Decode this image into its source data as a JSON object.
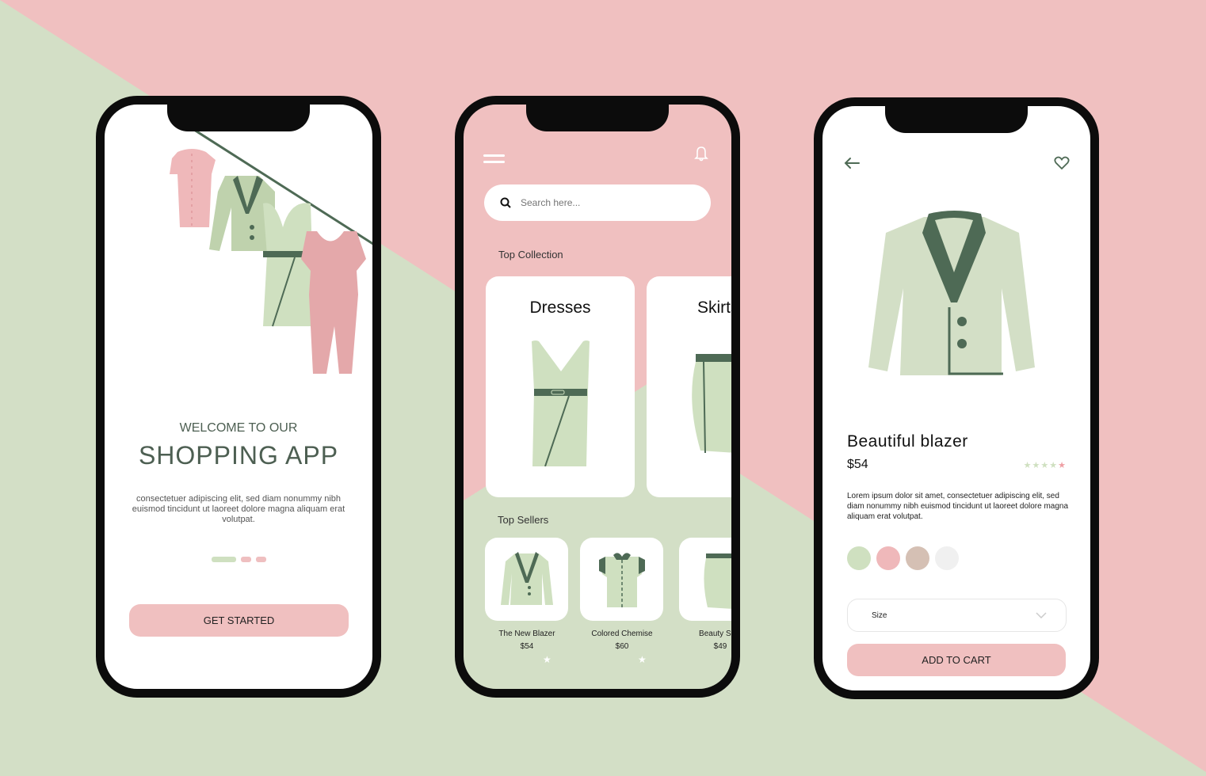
{
  "colors": {
    "pink": "#f0c0c0",
    "green": "#d3dfc6",
    "dark_green": "#4e6a55",
    "dress_pink": "#e4a8aa",
    "light_green": "#cfe0c0"
  },
  "welcome_screen": {
    "subtitle": "WELCOME TO OUR",
    "title": "SHOPPING APP",
    "description": "consectetuer adipiscing elit, sed diam nonummy nibh euismod tincidunt ut laoreet dolore magna aliquam erat volutpat.",
    "pager": {
      "total": 3,
      "active": 1
    },
    "cta_label": "GET STARTED"
  },
  "home_screen": {
    "menu_icon": "hamburger-icon",
    "bell_icon": "bell-icon",
    "search": {
      "placeholder": "Search here...",
      "value": ""
    },
    "top_collection_label": "Top Collection",
    "collections": [
      {
        "label": "Dresses"
      },
      {
        "label": "Skirts"
      }
    ],
    "top_sellers_label": "Top Sellers",
    "sellers": [
      {
        "name": "The New Blazer",
        "price": "$54"
      },
      {
        "name": "Colored Chemise",
        "price": "$60"
      },
      {
        "name": "Beauty Skirt",
        "price": "$49"
      }
    ]
  },
  "detail_screen": {
    "back_icon": "arrow-left-icon",
    "favorite_icon": "heart-icon",
    "title": "Beautiful blazer",
    "price": "$54",
    "rating": {
      "stars": 5,
      "highlighted": 1
    },
    "description": "Lorem ipsum dolor sit amet, consectetuer adipiscing elit, sed diam nonummy nibh euismod tincidunt ut laoreet dolore magna aliquam erat volutpat.",
    "swatches": [
      "#cfe0c0",
      "#efb8ba",
      "#d5c0b4",
      "#f0f0f0"
    ],
    "size_label": "Size",
    "cta_label": "ADD TO CART"
  }
}
